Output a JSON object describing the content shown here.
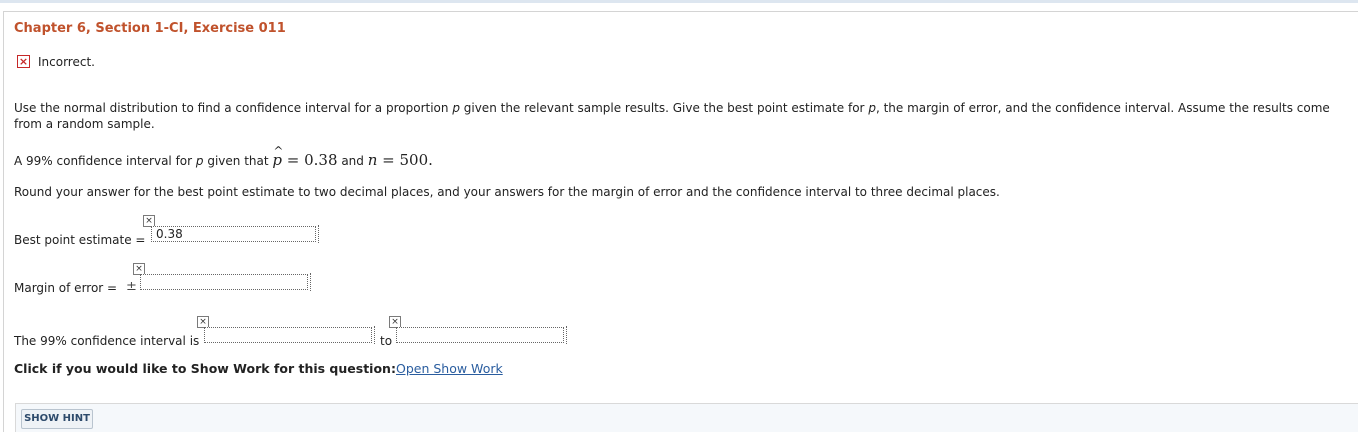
{
  "header": {
    "title": "Chapter 6, Section 1-CI, Exercise 011"
  },
  "status": {
    "mark": "×",
    "text": "Incorrect."
  },
  "question": {
    "intro_a": "Use the normal distribution to find a confidence interval for a proportion ",
    "p1": "p",
    "intro_b": " given the relevant sample results. Give the best point estimate for ",
    "p2": "p",
    "intro_c": ", the margin of error, and the confidence interval. Assume the results come from a random sample.",
    "given_a": "A 99% confidence interval for ",
    "p3": "p",
    "given_b": " given that ",
    "phat_var": "p",
    "phat_hat": "^",
    "phat_value": " = 0.38",
    "and": " and ",
    "n_var": "n",
    "n_value": " = 500.",
    "rounding": "Round your answer for the best point estimate to two decimal places, and your answers for the margin of error and the confidence interval to three decimal places."
  },
  "fields": {
    "point_estimate_label": "Best point estimate = ",
    "point_estimate_value": "0.38",
    "margin_label": "Margin of error = ",
    "margin_pm": "±",
    "margin_value": "",
    "interval_label": "The 99% confidence interval is",
    "interval_low": "",
    "interval_to": "to",
    "interval_high": ""
  },
  "marks": {
    "wrong": "×"
  },
  "show_work": {
    "label": "Click if you would like to Show Work for this question:",
    "link": "Open Show Work"
  },
  "hint": {
    "button": "SHOW HINT"
  },
  "colors": {
    "title": "#c0522c",
    "incorrect": "#c62828",
    "link": "#2a5d9f"
  }
}
